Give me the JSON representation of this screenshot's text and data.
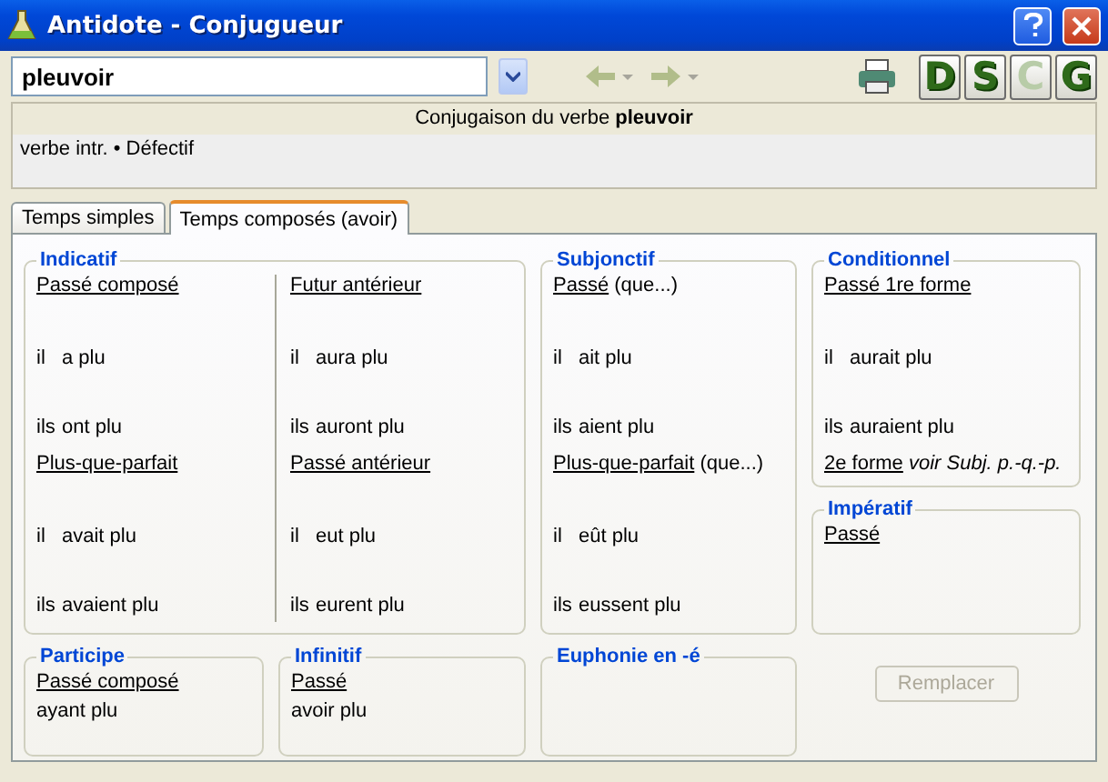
{
  "window": {
    "title": "Antidote - Conjugueur"
  },
  "search": {
    "value": "pleuvoir"
  },
  "nav_buttons": [
    {
      "kind": "back",
      "disabled": true
    },
    {
      "kind": "forward",
      "disabled": true
    }
  ],
  "letter_buttons": [
    {
      "label": "D",
      "disabled": false
    },
    {
      "label": "S",
      "disabled": false
    },
    {
      "label": "C",
      "disabled": true
    },
    {
      "label": "G",
      "disabled": false
    }
  ],
  "header": {
    "title": "Conjugaison du verbe **pleuvoir**",
    "info": "verbe intr. • Défectif"
  },
  "tabs": [
    {
      "label": "Temps simples",
      "selected": false
    },
    {
      "label": "Temps composés (avoir)",
      "selected": true
    }
  ],
  "groups": [
    {
      "title": "Indicatif",
      "columns": [
        [
          {
            "name": "Passé composé",
            "forms": [
              {
                "pronoun": "il",
                "verb": "a plu"
              },
              {
                "pronoun": "ils",
                "verb": "ont plu"
              }
            ]
          },
          {
            "name": "Plus-que-parfait",
            "forms": [
              {
                "pronoun": "il",
                "verb": "avait plu"
              },
              {
                "pronoun": "ils",
                "verb": "avaient plu"
              }
            ]
          }
        ],
        [
          {
            "name": "Futur antérieur",
            "forms": [
              {
                "pronoun": "il",
                "verb": "aura plu"
              },
              {
                "pronoun": "ils",
                "verb": "auront plu"
              }
            ]
          },
          {
            "name": "Passé antérieur",
            "forms": [
              {
                "pronoun": "il",
                "verb": "eut plu"
              },
              {
                "pronoun": "ils",
                "verb": "eurent plu"
              }
            ]
          }
        ]
      ]
    },
    {
      "title": "Subjonctif",
      "columns": [
        [
          {
            "name": "Passé",
            "suffix": "(que...)",
            "forms": [
              {
                "pronoun": "il",
                "verb": "ait plu"
              },
              {
                "pronoun": "ils",
                "verb": "aient plu"
              }
            ]
          },
          {
            "name": "Plus-que-parfait",
            "suffix": "(que...)",
            "forms": [
              {
                "pronoun": "il",
                "verb": "eût plu"
              },
              {
                "pronoun": "ils",
                "verb": "eussent plu"
              }
            ]
          }
        ]
      ]
    },
    {
      "title": "Conditionnel",
      "columns": [
        [
          {
            "name": "Passé 1re forme",
            "forms": [
              {
                "pronoun": "il",
                "verb": "aurait plu"
              },
              {
                "pronoun": "ils",
                "verb": "auraient plu"
              }
            ]
          },
          {
            "name": "2e forme",
            "note": "voir Subj. p.-q.-p."
          }
        ]
      ]
    },
    {
      "title": "Impératif",
      "columns": [
        [
          {
            "name": "Passé"
          }
        ]
      ]
    },
    {
      "title": "Participe",
      "columns": [
        [
          {
            "name": "Passé composé",
            "forms": [
              {
                "verb": "ayant plu"
              }
            ]
          }
        ]
      ]
    },
    {
      "title": "Infinitif",
      "columns": [
        [
          {
            "name": "Passé",
            "forms": [
              {
                "verb": "avoir plu"
              }
            ]
          }
        ]
      ]
    },
    {
      "title": "Euphonie en -é"
    }
  ],
  "replace_button": {
    "label": "Remplacer",
    "disabled": true
  }
}
